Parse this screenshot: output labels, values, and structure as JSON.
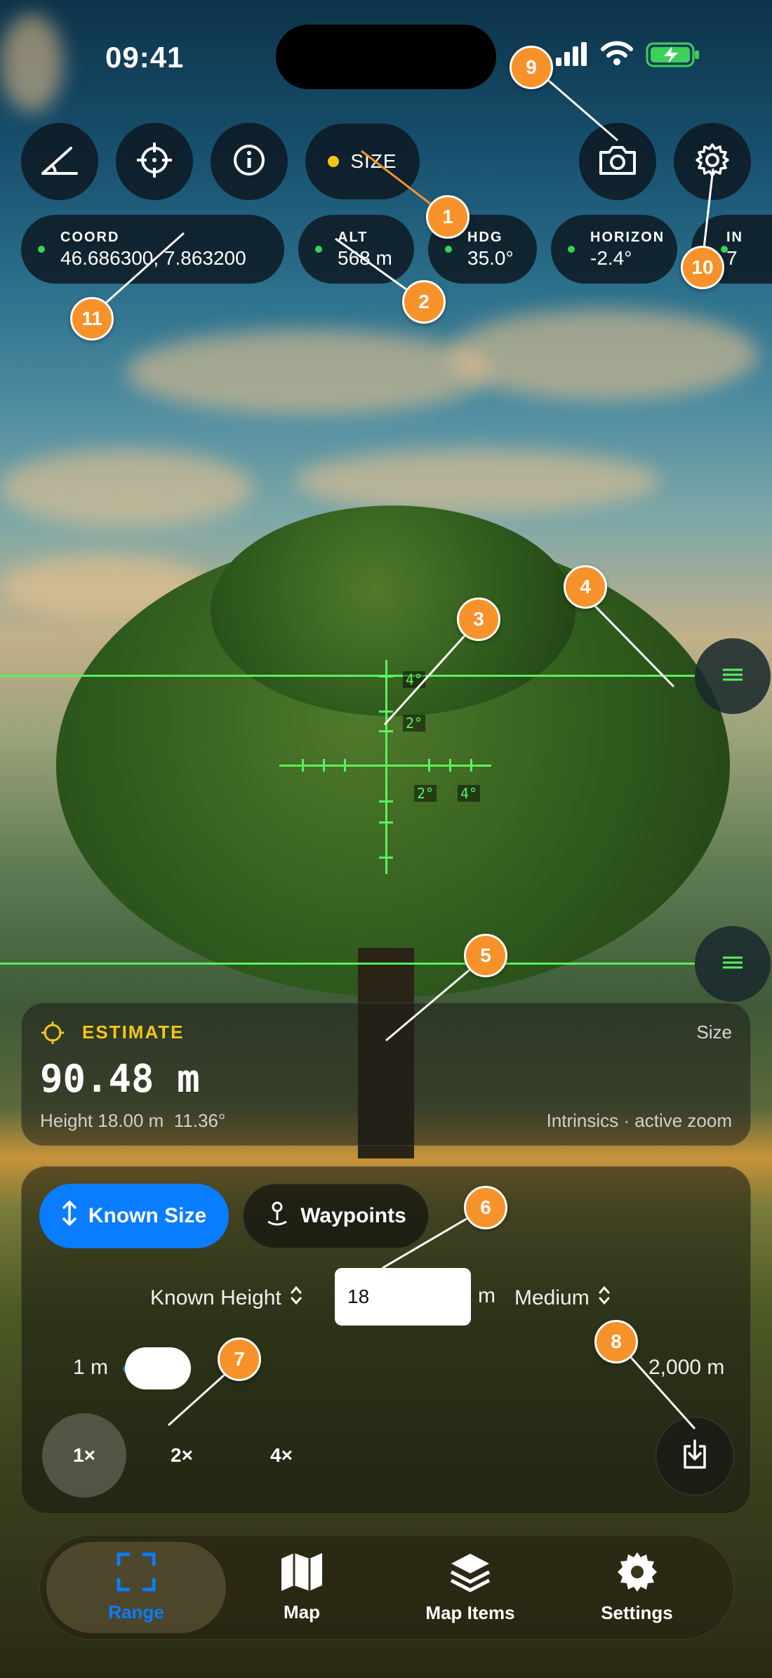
{
  "status_bar": {
    "time": "09:41"
  },
  "toolbar": {
    "mode_label": "SIZE",
    "icons": [
      "angle-icon",
      "crosshair-icon",
      "info-icon",
      "camera-icon",
      "gear-icon"
    ]
  },
  "telemetry": [
    {
      "label": "COORD",
      "value": "46.686300, 7.863200"
    },
    {
      "label": "ALT",
      "value": "568 m"
    },
    {
      "label": "HDG",
      "value": "35.0°"
    },
    {
      "label": "HORIZON",
      "value": "-2.4°"
    },
    {
      "label": "IN",
      "value": "7"
    }
  ],
  "reticle": {
    "labels": [
      "4°",
      "2°",
      "2°",
      "4°"
    ]
  },
  "estimate": {
    "title": "ESTIMATE",
    "mode": "Size",
    "value": "90.48 m",
    "height": "Height 18.00 m",
    "angle": "11.36°",
    "source": "Intrinsics · active zoom"
  },
  "controls": {
    "segments": [
      "Known Size",
      "Waypoints"
    ],
    "known_height_label": "Known Height",
    "known_height_value": "18",
    "unit": "m",
    "quality": "Medium",
    "range_min": "1 m",
    "range_max": "2,000 m",
    "zoom_levels": [
      "1×",
      "2×",
      "4×"
    ]
  },
  "callouts": [
    "1",
    "2",
    "3",
    "4",
    "5",
    "6",
    "7",
    "8",
    "9",
    "10",
    "11"
  ],
  "tabs": [
    {
      "label": "Range",
      "active": true
    },
    {
      "label": "Map",
      "active": false
    },
    {
      "label": "Map Items",
      "active": false
    },
    {
      "label": "Settings",
      "active": false
    }
  ],
  "colors": {
    "accent_blue": "#0a7cff",
    "reticle_green": "#59f35a",
    "callout_orange": "#f7922a",
    "estimate_yellow": "#f5c518"
  }
}
